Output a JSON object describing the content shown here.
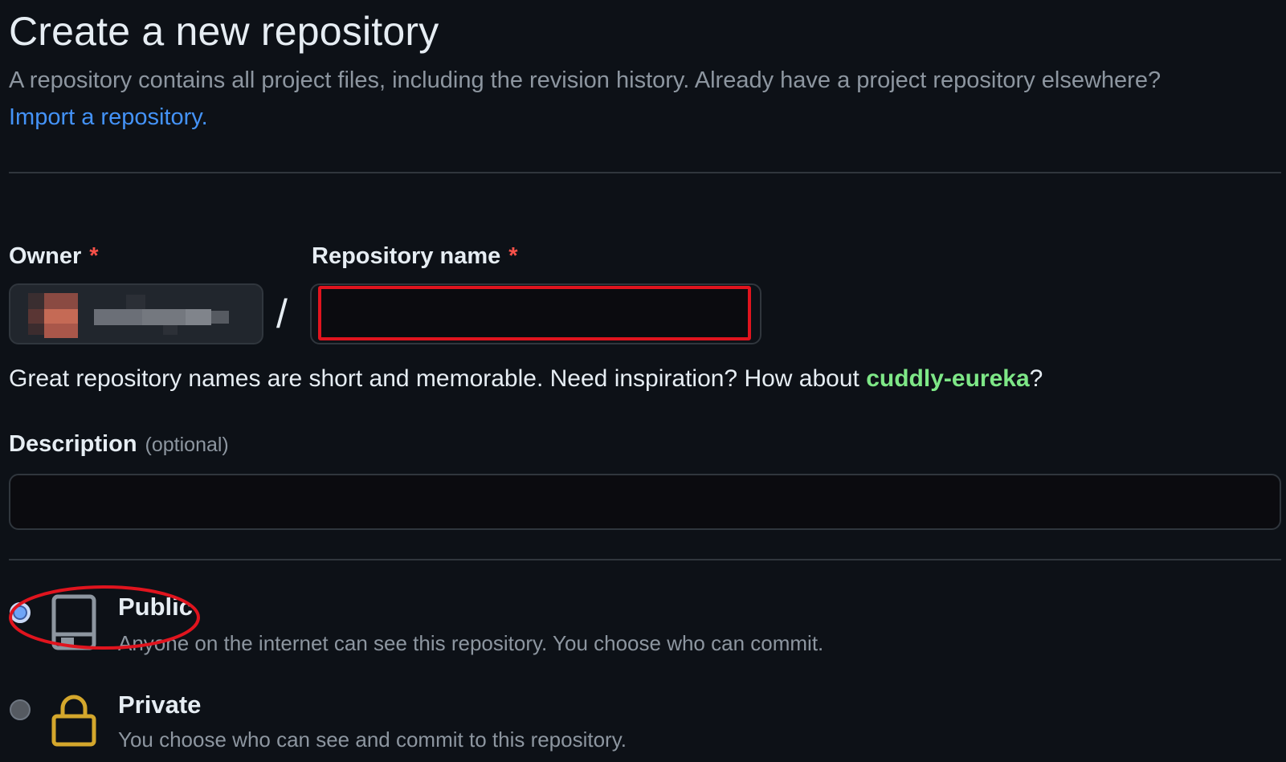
{
  "header": {
    "title": "Create a new repository",
    "subtitle": "A repository contains all project files, including the revision history. Already have a project repository elsewhere?",
    "import_link": "Import a repository."
  },
  "owner": {
    "label": "Owner",
    "required_mark": "*"
  },
  "separator": "/",
  "repo_name": {
    "label": "Repository name",
    "required_mark": "*",
    "value": "",
    "placeholder": ""
  },
  "name_hint": {
    "prefix": "Great repository names are short and memorable. Need inspiration? How about ",
    "suggestion": "cuddly-eureka",
    "suffix": "?"
  },
  "description": {
    "label": "Description",
    "optional": "(optional)",
    "value": "",
    "placeholder": ""
  },
  "visibility": {
    "selected": "public",
    "options": [
      {
        "key": "public",
        "title": "Public",
        "description": "Anyone on the internet can see this repository. You choose who can commit.",
        "icon": "repo-icon",
        "checked": true
      },
      {
        "key": "private",
        "title": "Private",
        "description": "You choose who can see and commit to this repository.",
        "icon": "lock-icon",
        "checked": false
      }
    ]
  },
  "colors": {
    "background": "#0d1117",
    "link": "#4493f8",
    "suggestion": "#7ee787",
    "required": "#f85149",
    "annotation": "#e0141e",
    "lock": "#d4a72c"
  }
}
